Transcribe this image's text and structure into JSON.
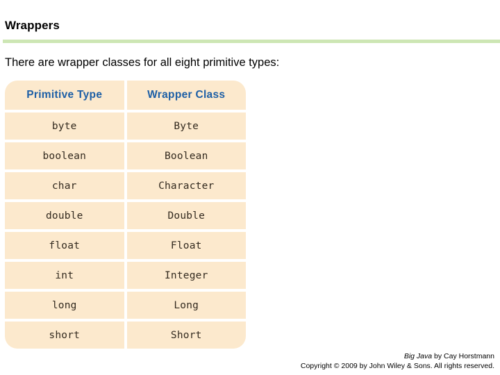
{
  "slide": {
    "title": "Wrappers",
    "rule_color": "#cde6b4",
    "body_text": "There are wrapper classes for all eight primitive types:"
  },
  "table": {
    "header_color": "#1d5fa6",
    "cell_background": "#fce9cd",
    "cell_text_color": "#332a1f",
    "columns": [
      "Primitive Type",
      "Wrapper Class"
    ],
    "rows": [
      [
        "byte",
        "Byte"
      ],
      [
        "boolean",
        "Boolean"
      ],
      [
        "char",
        "Character"
      ],
      [
        "double",
        "Double"
      ],
      [
        "float",
        "Float"
      ],
      [
        "int",
        "Integer"
      ],
      [
        "long",
        "Long"
      ],
      [
        "short",
        "Short"
      ]
    ]
  },
  "credits": {
    "book_title": "Big Java",
    "author_text": " by Cay Horstmann",
    "copyright": "Copyright © 2009 by John Wiley & Sons.  All rights reserved."
  }
}
